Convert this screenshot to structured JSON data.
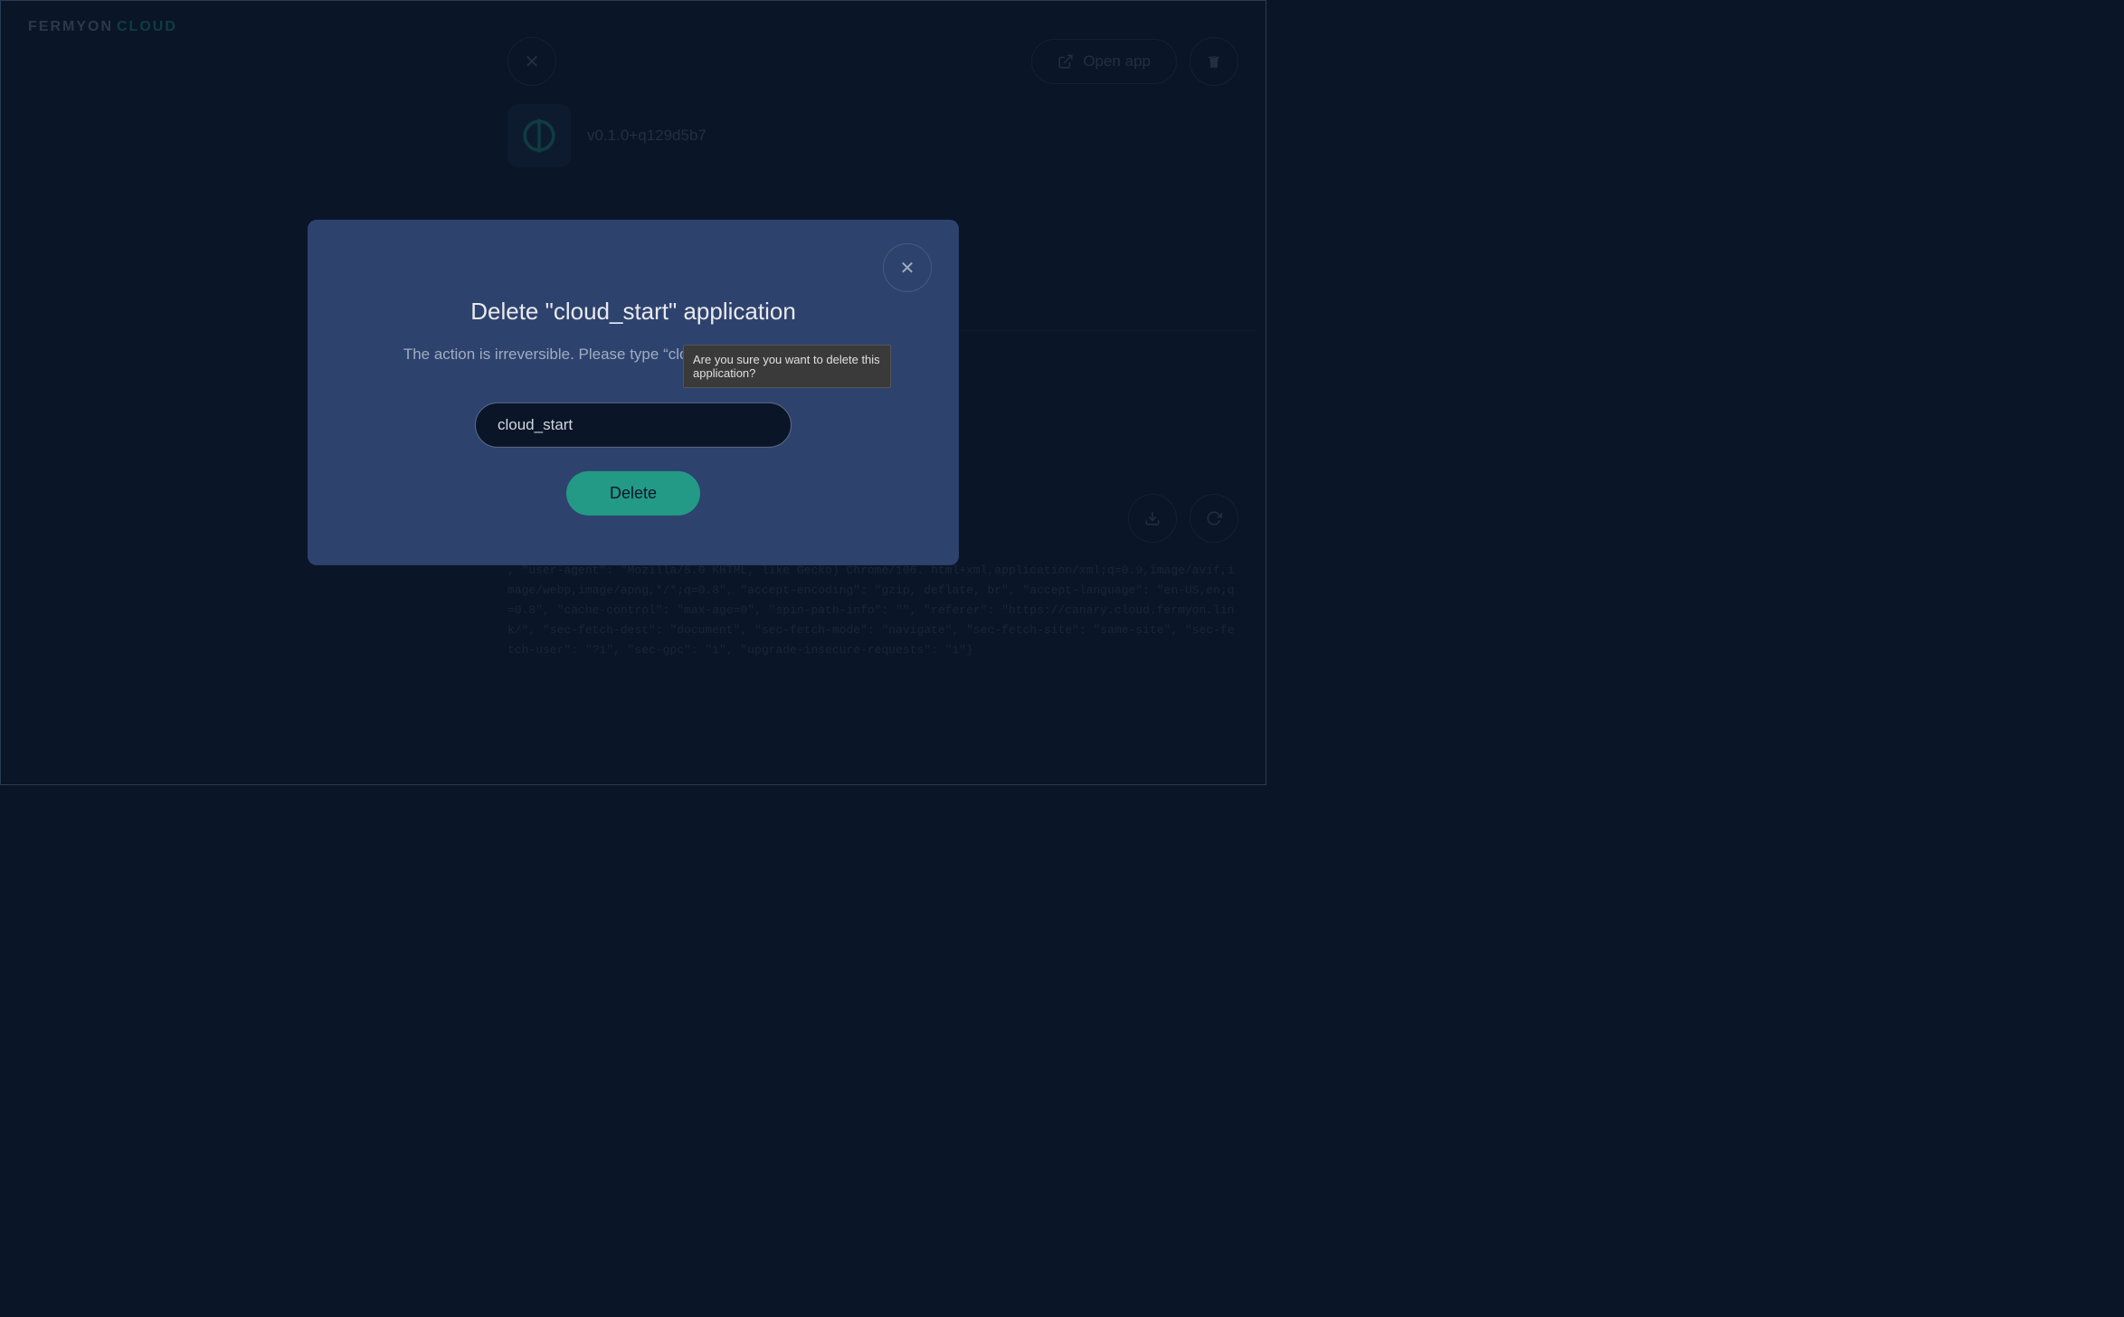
{
  "brand": {
    "fermyon": "FERMYON",
    "cloud": "CLOUD"
  },
  "header": {
    "open_app_label": "Open app"
  },
  "app": {
    "version": "v0.1.0+q129d5b7"
  },
  "modal": {
    "title": "Delete \"cloud_start\" application",
    "subtitle": "The action is irreversible. Please type “cloud_start” for confirmation.",
    "input_value": "cloud_start",
    "delete_label": "Delete"
  },
  "tooltip": {
    "text": "Are you sure you want to delete this application?"
  },
  "log": {
    "content": ", \"user-agent\": \"Mozilla/5.0 KHTML, like Gecko) Chrome/106. html+xml,application/xml;q=0.9,image/avif,image/webp,image/apng,*/*;q=0.8\", \"accept-encoding\": \"gzip, deflate, br\", \"accept-language\": \"en-US,en;q=0.8\", \"cache-control\": \"max-age=0\", \"spin-path-info\": \"\", \"referer\": \"https://canary.cloud.fermyon.link/\", \"sec-fetch-dest\": \"document\", \"sec-fetch-mode\": \"navigate\", \"sec-fetch-site\": \"same-site\", \"sec-fetch-user\": \"?1\", \"sec-gpc\": \"1\", \"upgrade-insecure-requests\": \"1\"}"
  }
}
